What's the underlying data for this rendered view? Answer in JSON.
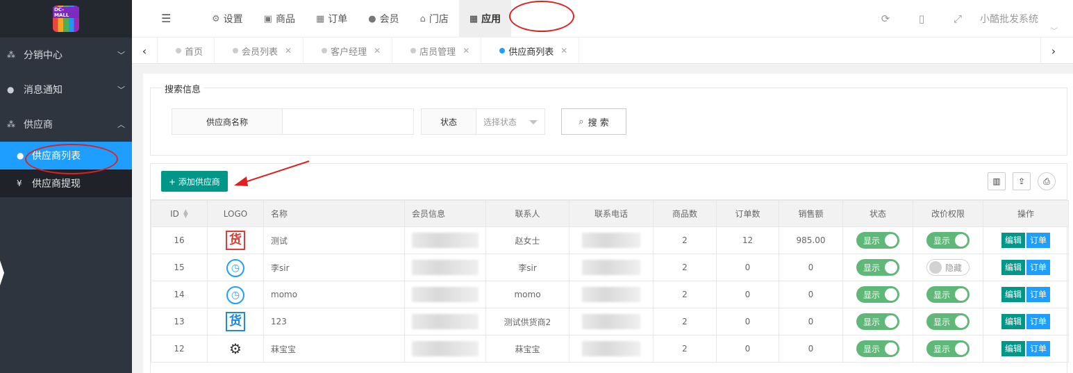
{
  "app": {
    "logo_text": "DC-MALL",
    "system_name": "小酷批发系统"
  },
  "topnav": [
    {
      "label": "设置",
      "icon": "gear-icon",
      "glyph": "⚙"
    },
    {
      "label": "商品",
      "icon": "bag-icon",
      "glyph": "▣"
    },
    {
      "label": "订单",
      "icon": "table-icon",
      "glyph": "▦"
    },
    {
      "label": "会员",
      "icon": "user-icon",
      "glyph": "●"
    },
    {
      "label": "门店",
      "icon": "bank-icon",
      "glyph": "⌂"
    },
    {
      "label": "应用",
      "icon": "grid-icon",
      "glyph": "▦"
    }
  ],
  "sidebar": {
    "groups": [
      {
        "label": "分销中心",
        "chevron": "﹀"
      },
      {
        "label": "消息通知",
        "chevron": "﹀"
      },
      {
        "label": "供应商",
        "chevron": "︿"
      }
    ],
    "sub_items": [
      {
        "label": "供应商列表",
        "glyph": "●"
      },
      {
        "label": "供应商提现",
        "glyph": "¥"
      }
    ]
  },
  "tabs": [
    {
      "label": "首页"
    },
    {
      "label": "会员列表"
    },
    {
      "label": "客户经理"
    },
    {
      "label": "店员管理"
    },
    {
      "label": "供应商列表"
    }
  ],
  "search": {
    "legend": "搜索信息",
    "name_label": "供应商名称",
    "name_value": "",
    "status_label": "状态",
    "status_placeholder": "选择状态",
    "button_label": "搜 索"
  },
  "toolbar": {
    "add_label": "+ 添加供应商"
  },
  "table": {
    "headers": [
      "ID",
      "LOGO",
      "名称",
      "会员信息",
      "联系人",
      "联系电话",
      "商品数",
      "订单数",
      "销售额",
      "状态",
      "改价权限",
      "操作"
    ],
    "rows": [
      {
        "id": "16",
        "logo": "huo-red",
        "name": "测试",
        "contact": "赵女士",
        "goods": "2",
        "orders": "12",
        "sales": "985.00",
        "status": "显示",
        "status_on": true,
        "price": "显示",
        "price_on": true
      },
      {
        "id": "15",
        "logo": "clock",
        "name": "李sir",
        "contact": "李sir",
        "goods": "2",
        "orders": "0",
        "sales": "0",
        "status": "显示",
        "status_on": true,
        "price": "隐藏",
        "price_on": false
      },
      {
        "id": "14",
        "logo": "clock",
        "name": "momo",
        "contact": "momo",
        "goods": "2",
        "orders": "0",
        "sales": "0",
        "status": "显示",
        "status_on": true,
        "price": "显示",
        "price_on": true
      },
      {
        "id": "13",
        "logo": "huo-blue",
        "name": "123",
        "contact": "测试供货商2",
        "goods": "2",
        "orders": "0",
        "sales": "0",
        "status": "显示",
        "status_on": true,
        "price": "显示",
        "price_on": true
      },
      {
        "id": "12",
        "logo": "gear",
        "name": "菻宝宝",
        "contact": "菻宝宝",
        "goods": "2",
        "orders": "0",
        "sales": "0",
        "status": "显示",
        "status_on": true,
        "price": "显示",
        "price_on": true
      }
    ],
    "edit_label": "编辑",
    "order_label": "订单"
  }
}
